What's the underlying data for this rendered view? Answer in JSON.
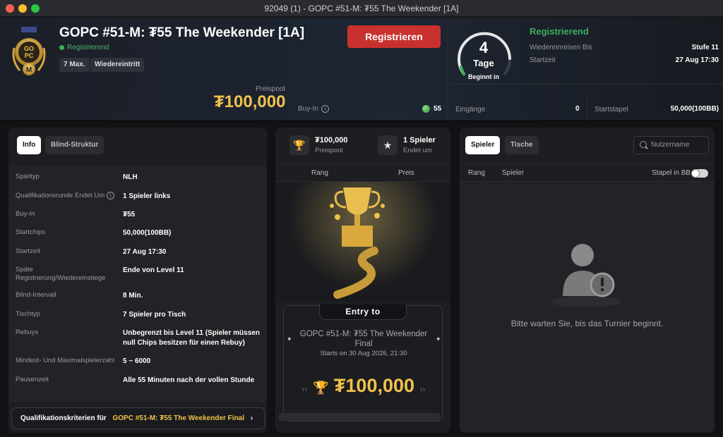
{
  "window": {
    "title": "92049 (1) - GOPC #51-M: ₮55 The Weekender [1A]"
  },
  "header": {
    "title": "GOPC #51-M: ₮55 The Weekender [1A]",
    "status": "Registrierend",
    "chips": [
      "7 Max.",
      "Wiedereintritt"
    ],
    "register_button": "Registrieren",
    "prize_pool_label": "Preispool",
    "prize_pool_value": "₮100,000",
    "buyin_label": "Buy-In",
    "buyin_value": "55",
    "countdown": {
      "number": "4",
      "unit": "Tage",
      "label": "Beginnt in",
      "progress": 0.85
    },
    "right_status": "Registrierend",
    "late_reg_label": "Wiedereinreisen Bis",
    "late_reg_value": "Stufe 11",
    "start_label": "Startzeit",
    "start_value": "27 Aug 17:30",
    "entries_label": "Eingänge",
    "entries_value": "0",
    "stack_label": "Startstapel",
    "stack_value": "50,000(100BB)"
  },
  "left_panel": {
    "tabs": [
      "Info",
      "Blind-Struktur"
    ],
    "rows": [
      {
        "key": "Spieltyp",
        "value": "NLH"
      },
      {
        "key": "Qualifikationsrunde Endet Um",
        "value": "1 Spieler links"
      },
      {
        "key": "Buy-In",
        "value": "₮55"
      },
      {
        "key": "Startchips",
        "value": "50,000(100BB)"
      },
      {
        "key": "Startzeit",
        "value": "27 Aug 17:30"
      },
      {
        "key": "Späte Registrierung/Wiedereinstiege",
        "value": "Ende von Level 11"
      },
      {
        "key": "Blind-Intervall",
        "value": "8 Min."
      },
      {
        "key": "Tischtyp",
        "value": "7 Spieler pro Tisch"
      },
      {
        "key": "Rebuys",
        "value": "Unbegrenzt bis Level 11 (Spieler müssen null Chips besitzen für einen Rebuy)"
      },
      {
        "key": "Mindest- Und Maximalspielerzahl",
        "value": "5 ~ 6000"
      },
      {
        "key": "Pausenzeit",
        "value": "Alle 55 Minuten nach der vollen Stunde"
      }
    ],
    "qual_prefix": "Qualifikationskriterien für",
    "qual_link": "GOPC #51-M: ₮55 The Weekender Final"
  },
  "mid_panel": {
    "prize_value": "₮100,000",
    "prize_label": "Preispool",
    "players_value": "1 Spieler",
    "players_label": "Endet um",
    "col_rank": "Rang",
    "col_prize": "Preis",
    "entry_tag": "Entry to",
    "entry_title": "GOPC #51-M: ₮55 The Weekender Final",
    "entry_sub": "Starts on 30 Aug 2026, 21:30",
    "entry_prize": "₮100,000"
  },
  "right_panel": {
    "tabs": [
      "Spieler",
      "Tische"
    ],
    "search_placeholder": "Nutzername",
    "col_rank": "Rang",
    "col_player": "Spieler",
    "toggle_label": "Stapel in BB",
    "wait_text": "Bitte warten Sie, bis das Turnier beginnt."
  },
  "colors": {
    "accent_gold": "#f0c24b",
    "register_red": "#c8312e",
    "status_green": "#3fae5f"
  }
}
